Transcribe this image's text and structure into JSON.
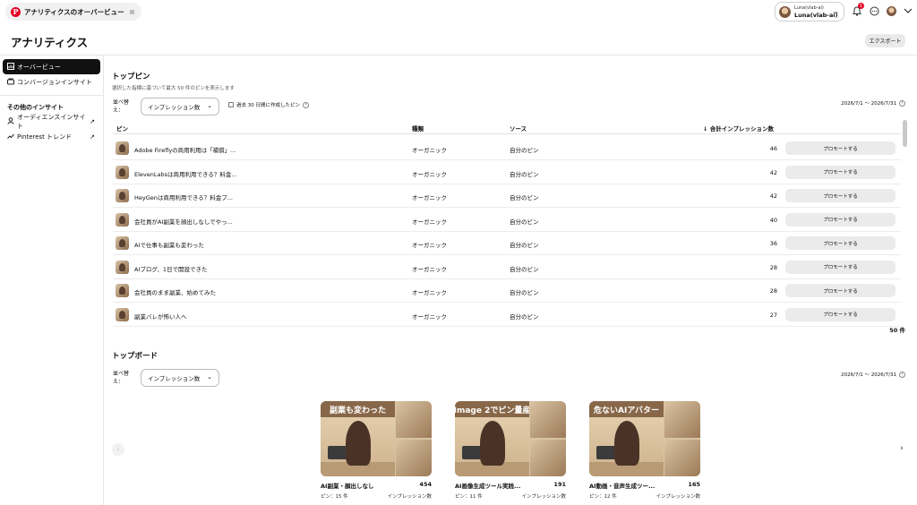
{
  "tab": {
    "title": "アナリティクスのオーバービュー"
  },
  "account": {
    "handle": "Luna(vlab-ai)",
    "name": "Luna(vlab-ai)"
  },
  "notifications": {
    "count": "1"
  },
  "page": {
    "title": "アナリティクス",
    "export_label": "エクスポート"
  },
  "sidebar": {
    "items": [
      {
        "label": "オーバービュー",
        "icon": "overview-icon"
      },
      {
        "label": "コンバージョンインサイト",
        "icon": "conversion-icon"
      }
    ],
    "other_heading": "その他のインサイト",
    "other_items": [
      {
        "label": "オーディエンスインサイト",
        "icon": "audience-icon"
      },
      {
        "label": "Pinterest トレンド",
        "icon": "trend-icon"
      }
    ]
  },
  "top_pins": {
    "title": "トップピン",
    "subtitle": "選択した指標に基づいて最大 50 件のピンを表示します",
    "sort_label": "並べ替え：",
    "sort_value": "インプレッション数",
    "checkbox_label": "過去 30 日間に作成したピン",
    "date_range": "2026/7/1 〜 2026/7/31",
    "columns": {
      "pin": "ピン",
      "type": "種類",
      "source": "ソース",
      "impressions": "↓ 合計インプレッション数"
    },
    "promote_label": "プロモートする",
    "rows": [
      {
        "title": "Adobe Fireflyの商用利用は「補償」...",
        "type": "オーガニック",
        "source": "自分のピン",
        "impressions": "46"
      },
      {
        "title": "ElevenLabsは商用利用できる？料金...",
        "type": "オーガニック",
        "source": "自分のピン",
        "impressions": "42"
      },
      {
        "title": "HeyGenは商用利用できる？料金プ...",
        "type": "オーガニック",
        "source": "自分のピン",
        "impressions": "42"
      },
      {
        "title": "会社員がAI副業を顔出しなしでやっ...",
        "type": "オーガニック",
        "source": "自分のピン",
        "impressions": "40"
      },
      {
        "title": "AIで仕事も副業も変わった",
        "type": "オーガニック",
        "source": "自分のピン",
        "impressions": "36"
      },
      {
        "title": "AIブログ、1日で開設できた",
        "type": "オーガニック",
        "source": "自分のピン",
        "impressions": "28"
      },
      {
        "title": "会社員のまま副業、始めてみた",
        "type": "オーガニック",
        "source": "自分のピン",
        "impressions": "28"
      },
      {
        "title": "副業バレが怖い人へ",
        "type": "オーガニック",
        "source": "自分のピン",
        "impressions": "27"
      }
    ],
    "total_count": "50 件"
  },
  "top_boards": {
    "title": "トップボード",
    "sort_label": "並べ替え：",
    "sort_value": "インプレッション数",
    "date_range": "2026/7/1 〜 2026/7/31",
    "boards": [
      {
        "cover_text": "副業も変わった",
        "title": "AI副業・顔出しなし",
        "impressions": "454",
        "pins": "ピン：15 件",
        "metric": "インプレッション数"
      },
      {
        "cover_text": "Image 2でピン量産",
        "title": "AI画像生成ツール実践...",
        "impressions": "191",
        "pins": "ピン：11 件",
        "metric": "インプレッション数"
      },
      {
        "cover_text": "危ないAIアバター",
        "title": "AI動画・音声生成ツー...",
        "impressions": "165",
        "pins": "ピン：12 件",
        "metric": "インプレッション数"
      }
    ]
  }
}
